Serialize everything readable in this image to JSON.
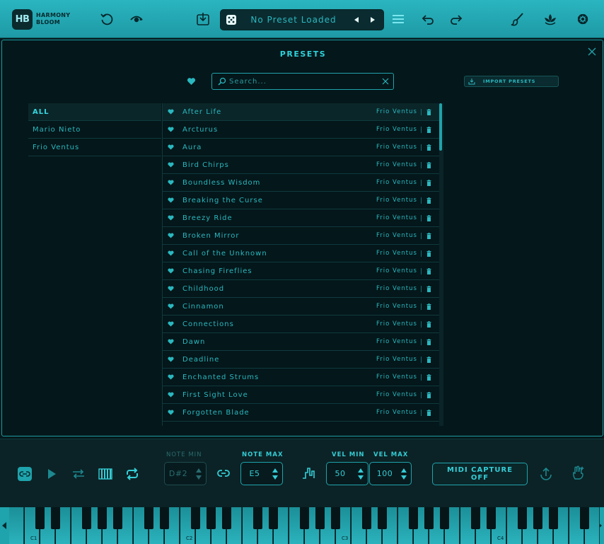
{
  "app": {
    "logo_mark": "HB",
    "logo_line1": "HARMONY",
    "logo_line2": "BLOOM"
  },
  "toolbar": {
    "preset_name": "No Preset Loaded"
  },
  "panel": {
    "title": "PRESETS",
    "search_placeholder": "Search...",
    "import_label": "IMPORT PRESETS",
    "authors": [
      "ALL",
      "Mario Nieto",
      "Frio Ventus"
    ],
    "presets": [
      {
        "name": "After Life",
        "author": "Frio Ventus"
      },
      {
        "name": "Arcturus",
        "author": "Frio Ventus"
      },
      {
        "name": "Aura",
        "author": "Frio Ventus"
      },
      {
        "name": "Bird Chirps",
        "author": "Frio Ventus"
      },
      {
        "name": "Boundless Wisdom",
        "author": "Frio Ventus"
      },
      {
        "name": "Breaking the Curse",
        "author": "Frio Ventus"
      },
      {
        "name": "Breezy Ride",
        "author": "Frio Ventus"
      },
      {
        "name": "Broken Mirror",
        "author": "Frio Ventus"
      },
      {
        "name": "Call of the Unknown",
        "author": "Frio Ventus"
      },
      {
        "name": "Chasing Fireflies",
        "author": "Frio Ventus"
      },
      {
        "name": "Childhood",
        "author": "Frio Ventus"
      },
      {
        "name": "Cinnamon",
        "author": "Frio Ventus"
      },
      {
        "name": "Connections",
        "author": "Frio Ventus"
      },
      {
        "name": "Dawn",
        "author": "Frio Ventus"
      },
      {
        "name": "Deadline",
        "author": "Frio Ventus"
      },
      {
        "name": "Enchanted Strums",
        "author": "Frio Ventus"
      },
      {
        "name": "First Sight Love",
        "author": "Frio Ventus"
      },
      {
        "name": "Forgotten Blade",
        "author": "Frio Ventus"
      }
    ]
  },
  "controls": {
    "note_min_label": "NOTE MIN",
    "note_min_value": "D#2",
    "note_max_label": "NOTE MAX",
    "note_max_value": "E5",
    "vel_min_label": "VEL MIN",
    "vel_min_value": "50",
    "vel_max_label": "VEL MAX",
    "vel_max_value": "100",
    "capture_line1": "MIDI CAPTURE",
    "capture_line2": "OFF"
  },
  "keyboard": {
    "octave_labels": [
      "C1",
      "C2",
      "C3",
      "C4"
    ]
  },
  "colors": {
    "accent": "#2ab8c0",
    "topbar": "#23a9b4",
    "background": "#04171a"
  }
}
